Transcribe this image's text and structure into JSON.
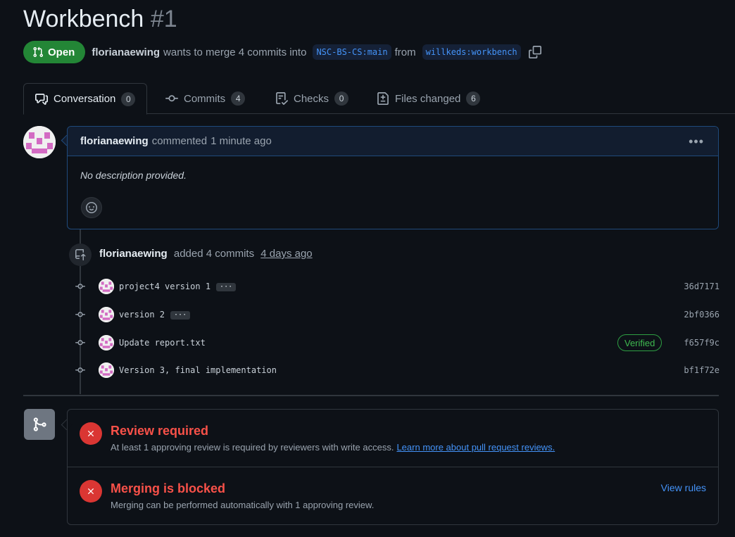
{
  "pr": {
    "title": "Workbench",
    "number": "#1",
    "state": "Open",
    "author": "florianaewing",
    "wants_text": "wants to merge 4 commits into",
    "base_branch": "NSC-BS-CS:main",
    "from_text": "from",
    "head_branch": "willkeds:workbench"
  },
  "tabs": [
    {
      "label": "Conversation",
      "count": "0",
      "icon": "comment-discussion-icon"
    },
    {
      "label": "Commits",
      "count": "4",
      "icon": "git-commit-icon"
    },
    {
      "label": "Checks",
      "count": "0",
      "icon": "checklist-icon"
    },
    {
      "label": "Files changed",
      "count": "6",
      "icon": "file-diff-icon"
    }
  ],
  "comment": {
    "author": "florianaewing",
    "action": "commented",
    "time": "1 minute ago",
    "body": "No description provided."
  },
  "commits_event": {
    "author": "florianaewing",
    "action": "added 4 commits",
    "time": "4 days ago"
  },
  "commits": [
    {
      "message": "project4 version 1",
      "sha": "36d7171",
      "has_more": true,
      "verified": false
    },
    {
      "message": "version 2",
      "sha": "2bf0366",
      "has_more": true,
      "verified": false
    },
    {
      "message": "Update report.txt",
      "sha": "f657f9c",
      "has_more": false,
      "verified": true,
      "verified_label": "Verified"
    },
    {
      "message": "Version 3, final implementation",
      "sha": "bf1f72e",
      "has_more": false,
      "verified": false
    }
  ],
  "more_label": "···",
  "merge": {
    "review": {
      "title": "Review required",
      "desc": "At least 1 approving review is required by reviewers with write access.",
      "link": "Learn more about pull request reviews."
    },
    "blocked": {
      "title": "Merging is blocked",
      "desc": "Merging can be performed automatically with 1 approving review.",
      "action": "View rules"
    }
  },
  "colors": {
    "open_green": "#238636",
    "link_blue": "#4493f8",
    "error_red": "#da3633",
    "avatar_pink": "#d36bc3"
  }
}
